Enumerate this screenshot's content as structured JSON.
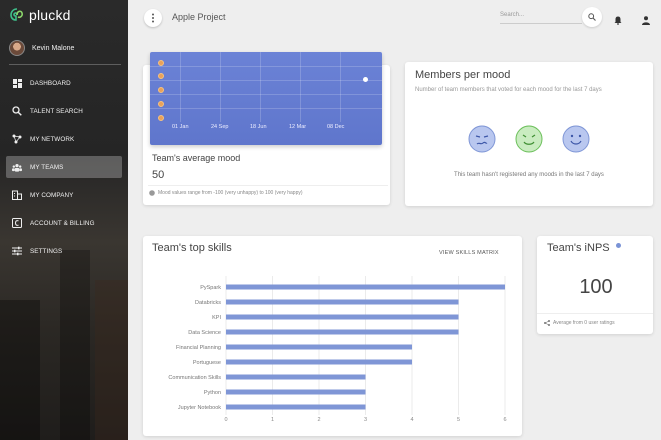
{
  "app": {
    "brand": "pluckd",
    "project": "Apple Project"
  },
  "user": {
    "name": "Kevin Malone"
  },
  "nav": {
    "items": [
      {
        "label": "DASHBOARD",
        "icon": "dashboard-icon"
      },
      {
        "label": "TALENT SEARCH",
        "icon": "search-person-icon"
      },
      {
        "label": "MY NETWORK",
        "icon": "network-icon"
      },
      {
        "label": "MY TEAMS",
        "icon": "teams-icon",
        "active": true
      },
      {
        "label": "MY COMPANY",
        "icon": "company-icon"
      },
      {
        "label": "ACCOUNT & BILLING",
        "icon": "billing-icon"
      },
      {
        "label": "SETTINGS",
        "icon": "settings-sliders-icon"
      }
    ]
  },
  "topbar": {
    "search_placeholder": "Search..."
  },
  "average_mood": {
    "title": "Team's average mood",
    "value": "50",
    "note": "Mood values range from -100 (very unhappy) to 100 (very happy)",
    "x_labels": [
      "01 Jan",
      "24 Sep",
      "18 Jun",
      "12 Mar",
      "08 Dec"
    ]
  },
  "members_per_mood": {
    "title": "Members per mood",
    "subtitle": "Number of team members that voted for each mood for the last 7 days",
    "note": "This team hasn't registered any moods in the last 7 days"
  },
  "top_skills": {
    "title": "Team's top skills",
    "link": "VIEW SKILLS MATRIX"
  },
  "chart_data": {
    "type": "bar",
    "orientation": "horizontal",
    "categories": [
      "PySpark",
      "Databricks",
      "KPI",
      "Data Science",
      "Financial Planning",
      "Portuguese",
      "Communication Skills",
      "Python",
      "Jupyter Notebook"
    ],
    "values": [
      6,
      5,
      5,
      5,
      4,
      4,
      3,
      3,
      3
    ],
    "xlim": [
      0,
      6
    ],
    "xticks": [
      "0",
      "1",
      "2",
      "3",
      "4",
      "5",
      "6"
    ],
    "color": "#7f96d6",
    "grid": true
  },
  "inps": {
    "title": "Team's iNPS",
    "value": "100",
    "note": "Average from 0 user ratings"
  }
}
